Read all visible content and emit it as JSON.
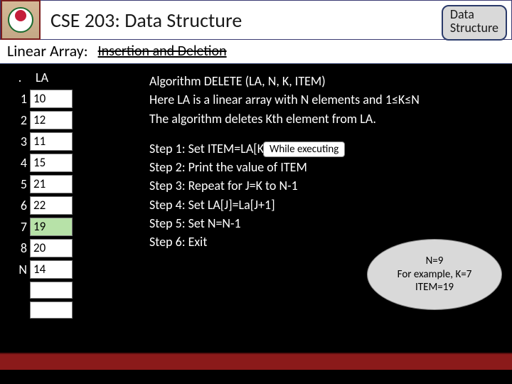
{
  "header": {
    "course_title": "CSE 203: Data Structure",
    "badge_line1": "Data",
    "badge_line2": "Structure"
  },
  "subheader": {
    "section_label": "Linear Array:",
    "topic": "Insertion and Deletion"
  },
  "array": {
    "dot": ".",
    "header": "LA",
    "rows": [
      {
        "idx": "1",
        "val": "10",
        "hl": false
      },
      {
        "idx": "2",
        "val": "12",
        "hl": false
      },
      {
        "idx": "3",
        "val": "11",
        "hl": false
      },
      {
        "idx": "4",
        "val": "15",
        "hl": false
      },
      {
        "idx": "5",
        "val": "21",
        "hl": false
      },
      {
        "idx": "6",
        "val": "22",
        "hl": false
      },
      {
        "idx": "7",
        "val": "19",
        "hl": true
      },
      {
        "idx": "8",
        "val": "20",
        "hl": false
      },
      {
        "idx": "N",
        "val": "14",
        "hl": false
      }
    ]
  },
  "algo": {
    "line1": "Algorithm DELETE (LA, N, K, ITEM)",
    "line2": "Here LA is a linear array with N elements and 1≤K≤N",
    "line3": "The algorithm deletes Kth element from LA.",
    "s1": "Step 1: Set ITEM=LA[K]",
    "s2": "Step 2: Print the value of ITEM",
    "s3": "Step 3: Repeat for J=K to N-1",
    "s4": "Step 4: Set LA[J]=La[J+1]",
    "s5": "Step 5: Set N=N-1",
    "s6": "Step 6: Exit"
  },
  "callout1": "While executing",
  "bubble": {
    "l1": "N=9",
    "l2": "For example, K=7",
    "l3": "ITEM=19"
  }
}
